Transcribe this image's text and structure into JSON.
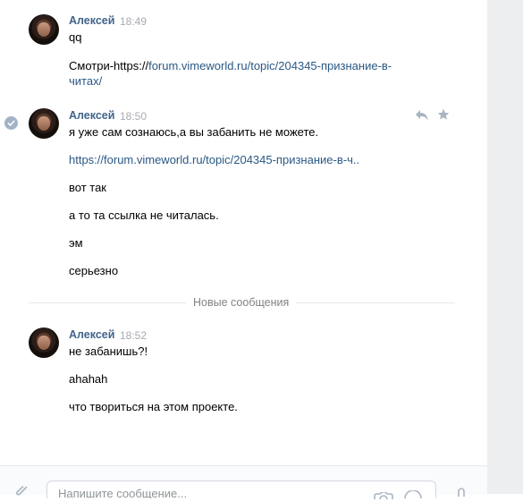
{
  "messages": [
    {
      "author": "Алексей",
      "time": "18:49",
      "lines": [
        {
          "text": "qq"
        },
        {
          "prefix": "Смотри-https://",
          "link": "forum.vimeworld.ru/topic/204345-признание-в-"
        },
        {
          "link": "читах/"
        }
      ]
    },
    {
      "author": "Алексей",
      "time": "18:50",
      "lines": [
        {
          "text": "я уже сам сознаюсь,а вы забанить не можете."
        },
        {
          "link": "https://forum.vimeworld.ru/topic/204345-признание-в-ч.."
        },
        {
          "text": "вот так"
        },
        {
          "text": "а то та ссылка не читалась."
        },
        {
          "text": "эм"
        },
        {
          "text": "серьезно"
        }
      ]
    },
    {
      "author": "Алексей",
      "time": "18:52",
      "lines": [
        {
          "text": "не забанишь?!"
        },
        {
          "text": "ahahah"
        },
        {
          "text": "что твориться на этом проекте."
        }
      ]
    }
  ],
  "divider": {
    "label": "Новые сообщения"
  },
  "composer": {
    "placeholder": "Напишите сообщение..."
  },
  "icons": {
    "read": "check-icon",
    "reply": "reply-icon",
    "favorite": "star-icon",
    "attach": "paperclip-icon",
    "camera": "camera-icon",
    "emoji": "smile-icon",
    "voice": "mic-icon"
  },
  "colors": {
    "author": "#42648b",
    "link": "#2a5885",
    "time": "#a8aab0",
    "divider_text": "#828282",
    "sidebar": "#edeef0"
  }
}
